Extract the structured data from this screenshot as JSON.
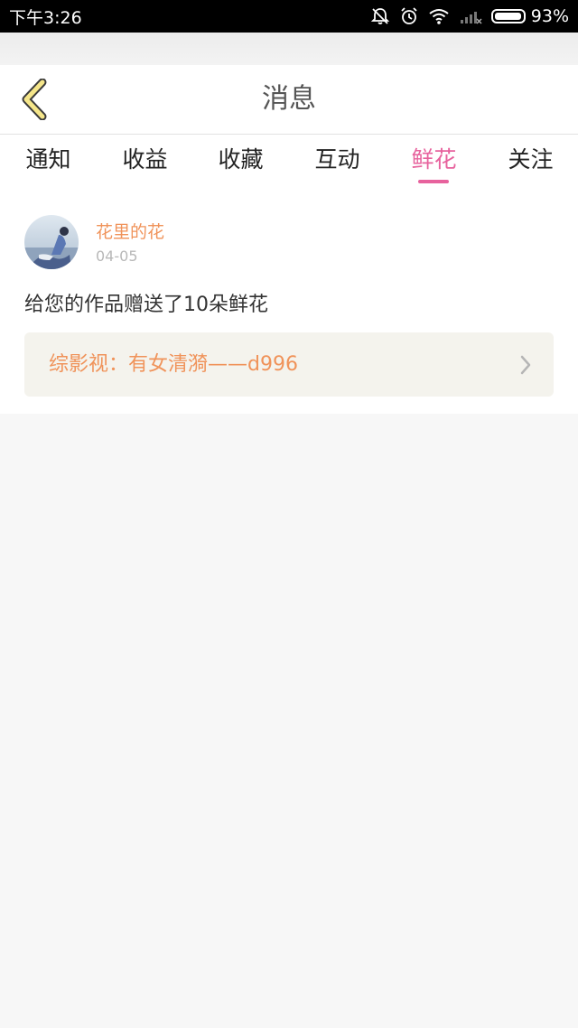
{
  "status_bar": {
    "time": "下午3:26",
    "battery": "93%",
    "icons": [
      "bell-off-icon",
      "alarm-icon",
      "wifi-icon",
      "signal-icon",
      "battery-icon"
    ]
  },
  "header": {
    "title": "消息",
    "back_icon": "chevron-left-icon",
    "back_color": "#f5e68a"
  },
  "tabs": [
    {
      "label": "通知",
      "active": false
    },
    {
      "label": "收益",
      "active": false
    },
    {
      "label": "收藏",
      "active": false
    },
    {
      "label": "互动",
      "active": false
    },
    {
      "label": "鲜花",
      "active": true
    },
    {
      "label": "关注",
      "active": false
    }
  ],
  "accent_color": "#e7629d",
  "notification": {
    "username": "花里的花",
    "date": "04-05",
    "message": "给您的作品赠送了10朵鲜花",
    "work_title": "综影视：有女清漪——d996",
    "chevron_icon": "chevron-right-icon"
  }
}
